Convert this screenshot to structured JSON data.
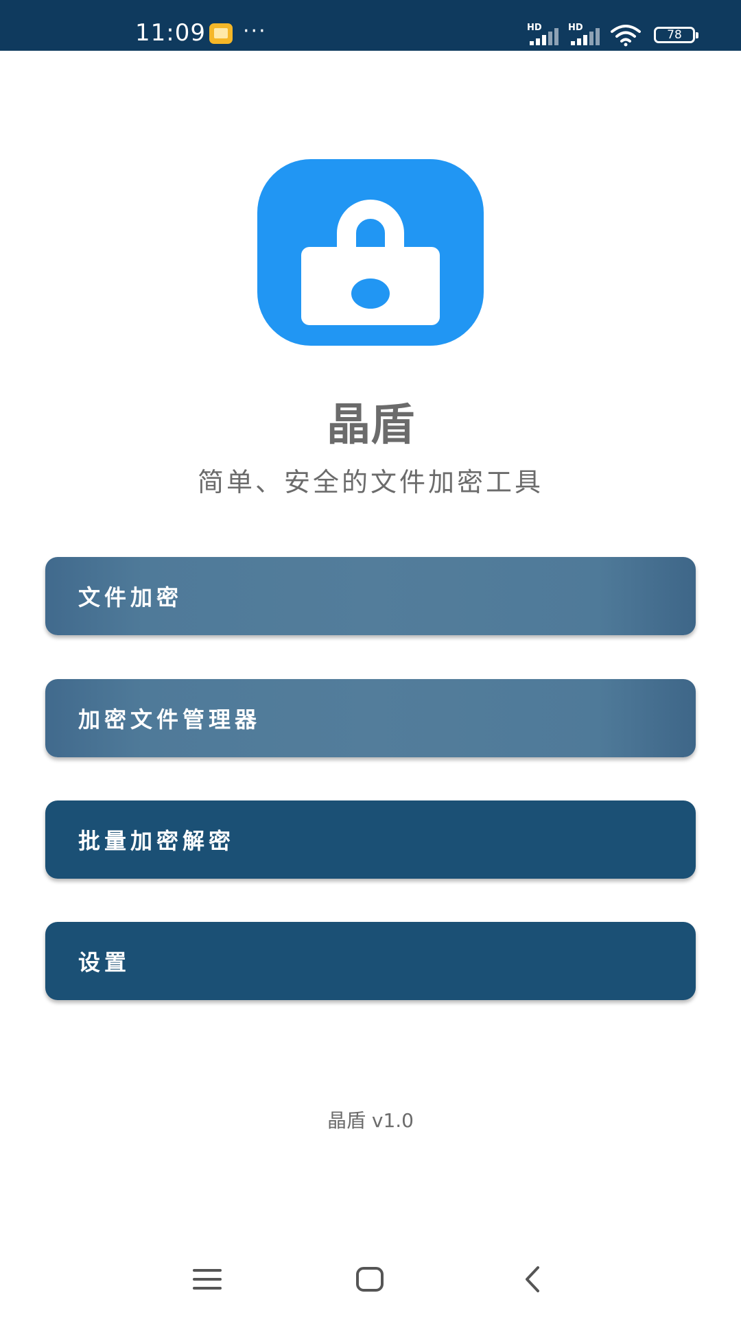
{
  "status_bar": {
    "time": "11:09",
    "more": "···",
    "network_label_1": "HD",
    "network_label_2": "HD",
    "battery_level": "78",
    "icons": [
      "notification-app-icon",
      "signal-icon",
      "signal-icon",
      "wifi-icon",
      "battery-icon"
    ]
  },
  "app": {
    "icon": "lock-icon",
    "title": "晶盾",
    "subtitle": "简单、安全的文件加密工具",
    "version": "晶盾 v1.0"
  },
  "menu": [
    {
      "label": "文件加密"
    },
    {
      "label": "加密文件管理器"
    },
    {
      "label": "批量加密解密"
    },
    {
      "label": "设置"
    }
  ],
  "nav_bar": {
    "icons": [
      "menu-icon",
      "home-icon",
      "back-icon"
    ]
  },
  "colors": {
    "status_bar_bg": "#0f3a5e",
    "icon_bg": "#2196f3",
    "button_light": "#537d9b",
    "button_dark": "#1b5075",
    "text_gray": "#6b6b6b"
  }
}
